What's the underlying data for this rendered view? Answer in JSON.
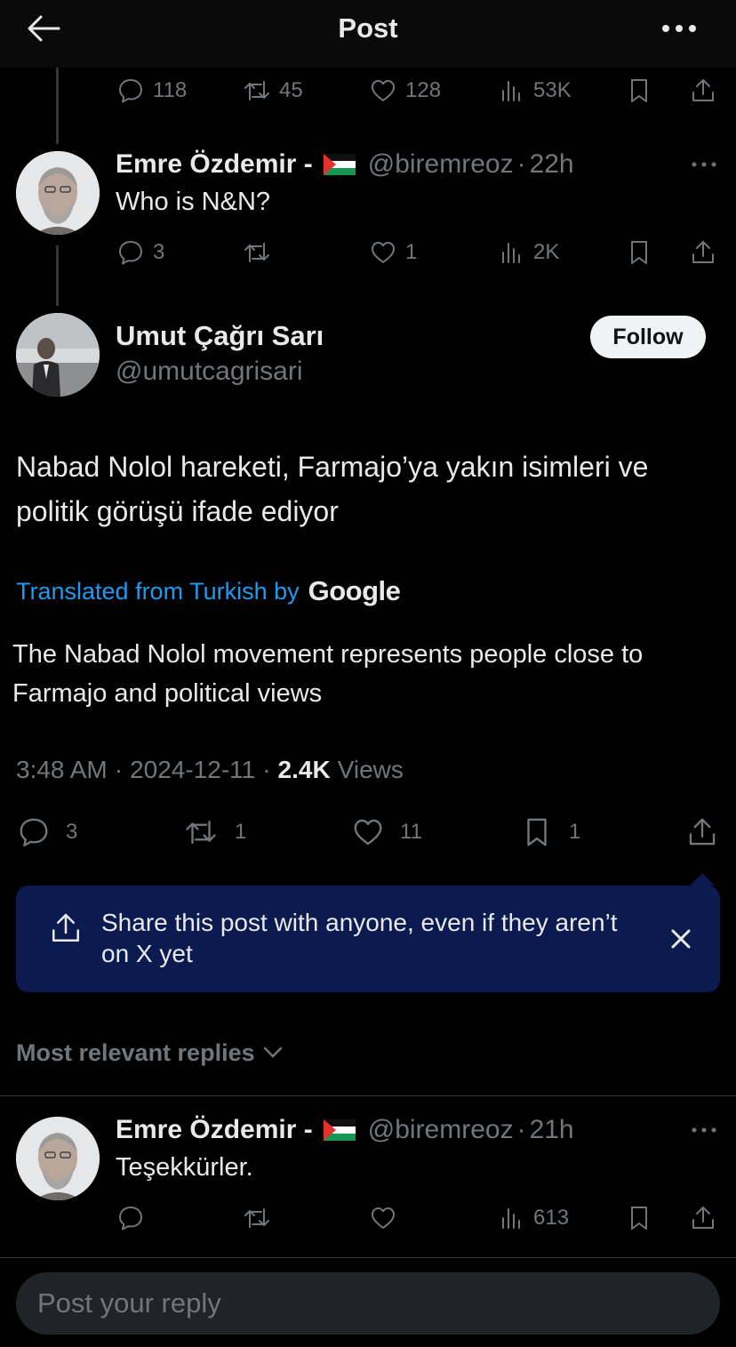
{
  "header": {
    "title": "Post"
  },
  "prev_actions": {
    "replies": "118",
    "reposts": "45",
    "likes": "128",
    "views": "53K"
  },
  "reply1": {
    "name": "Emre Özdemir -",
    "handle": "@biremreoz",
    "sep": "·",
    "time": "22h",
    "text": "Who is N&N?",
    "replies": "3",
    "likes": "1",
    "views": "2K"
  },
  "main_post": {
    "name": "Umut Çağrı Sarı",
    "handle": "@umutcagrisari",
    "follow_label": "Follow",
    "text": "Nabad Nolol hareketi, Farmajo’ya yakın isimleri ve politik görüşü ifade ediyor",
    "translated_label": "Translated from Turkish by",
    "google_label": "Google",
    "translated_text": "The Nabad Nolol movement represents people close to Farmajo and political views",
    "time": "3:48 AM",
    "date": "2024-12-11",
    "sep": "·",
    "views_count": "2.4K",
    "views_label": "Views",
    "replies": "3",
    "reposts": "1",
    "likes": "11",
    "bookmarks": "1"
  },
  "share_prompt": {
    "text": "Share this post with anyone, even if they aren’t on X yet"
  },
  "sort": {
    "label": "Most relevant replies"
  },
  "reply2": {
    "name": "Emre Özdemir -",
    "handle": "@biremreoz",
    "sep": "·",
    "time": "21h",
    "text": "Teşekkürler.",
    "views": "613"
  },
  "composer": {
    "placeholder": "Post your reply"
  },
  "colors": {
    "background": "#000000",
    "accent": "#1d9bf0",
    "muted": "#71767b",
    "share_card": "#0c1b4f"
  },
  "icons": [
    "back-arrow-icon",
    "more-icon",
    "reply-icon",
    "repost-icon",
    "like-icon",
    "views-icon",
    "bookmark-icon",
    "share-icon",
    "close-icon",
    "chevron-down-icon",
    "palestine-flag-icon"
  ]
}
